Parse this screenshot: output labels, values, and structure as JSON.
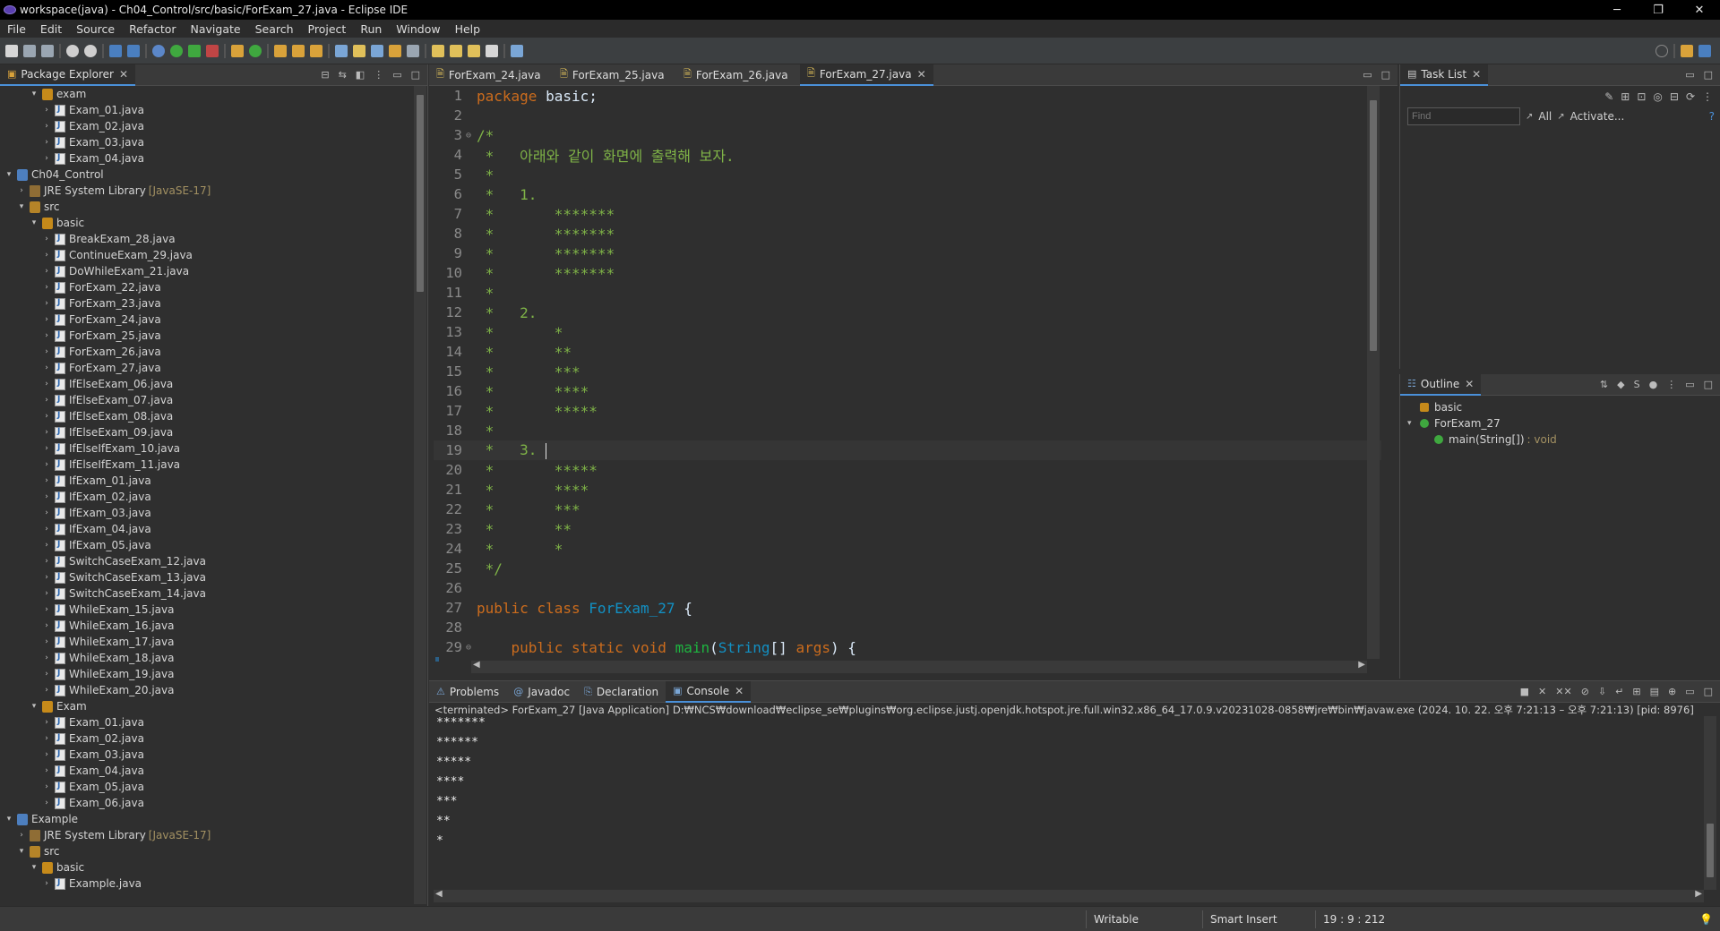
{
  "window": {
    "title": "workspace(java) - Ch04_Control/src/basic/ForExam_27.java - Eclipse IDE",
    "controls": [
      "─",
      "❐",
      "✕"
    ]
  },
  "menu": [
    "File",
    "Edit",
    "Source",
    "Refactor",
    "Navigate",
    "Search",
    "Project",
    "Run",
    "Window",
    "Help"
  ],
  "package_explorer": {
    "title": "Package Explorer",
    "items": [
      {
        "label": "exam",
        "indent": 2,
        "icon": "pkg",
        "twisty": "▾"
      },
      {
        "label": "Exam_01.java",
        "indent": 3,
        "icon": "java",
        "twisty": "›"
      },
      {
        "label": "Exam_02.java",
        "indent": 3,
        "icon": "java",
        "twisty": "›"
      },
      {
        "label": "Exam_03.java",
        "indent": 3,
        "icon": "java",
        "twisty": "›"
      },
      {
        "label": "Exam_04.java",
        "indent": 3,
        "icon": "java",
        "twisty": "›"
      },
      {
        "label": "Ch04_Control",
        "indent": 0,
        "icon": "proj",
        "twisty": "▾"
      },
      {
        "label": "JRE System Library",
        "extra": "[JavaSE-17]",
        "indent": 1,
        "icon": "lib",
        "twisty": "›"
      },
      {
        "label": "src",
        "indent": 1,
        "icon": "src",
        "twisty": "▾"
      },
      {
        "label": "basic",
        "indent": 2,
        "icon": "pkg",
        "twisty": "▾"
      },
      {
        "label": "BreakExam_28.java",
        "indent": 3,
        "icon": "java",
        "twisty": "›"
      },
      {
        "label": "ContinueExam_29.java",
        "indent": 3,
        "icon": "java",
        "twisty": "›"
      },
      {
        "label": "DoWhileExam_21.java",
        "indent": 3,
        "icon": "java",
        "twisty": "›"
      },
      {
        "label": "ForExam_22.java",
        "indent": 3,
        "icon": "java",
        "twisty": "›"
      },
      {
        "label": "ForExam_23.java",
        "indent": 3,
        "icon": "java",
        "twisty": "›"
      },
      {
        "label": "ForExam_24.java",
        "indent": 3,
        "icon": "java",
        "twisty": "›"
      },
      {
        "label": "ForExam_25.java",
        "indent": 3,
        "icon": "java",
        "twisty": "›"
      },
      {
        "label": "ForExam_26.java",
        "indent": 3,
        "icon": "java",
        "twisty": "›"
      },
      {
        "label": "ForExam_27.java",
        "indent": 3,
        "icon": "java",
        "twisty": "›"
      },
      {
        "label": "IfElseExam_06.java",
        "indent": 3,
        "icon": "java",
        "twisty": "›"
      },
      {
        "label": "IfElseExam_07.java",
        "indent": 3,
        "icon": "java",
        "twisty": "›"
      },
      {
        "label": "IfElseExam_08.java",
        "indent": 3,
        "icon": "java",
        "twisty": "›"
      },
      {
        "label": "IfElseExam_09.java",
        "indent": 3,
        "icon": "java",
        "twisty": "›"
      },
      {
        "label": "IfElseIfExam_10.java",
        "indent": 3,
        "icon": "java",
        "twisty": "›"
      },
      {
        "label": "IfElseIfExam_11.java",
        "indent": 3,
        "icon": "java",
        "twisty": "›"
      },
      {
        "label": "IfExam_01.java",
        "indent": 3,
        "icon": "java",
        "twisty": "›"
      },
      {
        "label": "IfExam_02.java",
        "indent": 3,
        "icon": "java",
        "twisty": "›"
      },
      {
        "label": "IfExam_03.java",
        "indent": 3,
        "icon": "java",
        "twisty": "›"
      },
      {
        "label": "IfExam_04.java",
        "indent": 3,
        "icon": "java",
        "twisty": "›"
      },
      {
        "label": "IfExam_05.java",
        "indent": 3,
        "icon": "java",
        "twisty": "›"
      },
      {
        "label": "SwitchCaseExam_12.java",
        "indent": 3,
        "icon": "java",
        "twisty": "›"
      },
      {
        "label": "SwitchCaseExam_13.java",
        "indent": 3,
        "icon": "java",
        "twisty": "›"
      },
      {
        "label": "SwitchCaseExam_14.java",
        "indent": 3,
        "icon": "java",
        "twisty": "›"
      },
      {
        "label": "WhileExam_15.java",
        "indent": 3,
        "icon": "java",
        "twisty": "›"
      },
      {
        "label": "WhileExam_16.java",
        "indent": 3,
        "icon": "java",
        "twisty": "›"
      },
      {
        "label": "WhileExam_17.java",
        "indent": 3,
        "icon": "java",
        "twisty": "›"
      },
      {
        "label": "WhileExam_18.java",
        "indent": 3,
        "icon": "java",
        "twisty": "›"
      },
      {
        "label": "WhileExam_19.java",
        "indent": 3,
        "icon": "java",
        "twisty": "›"
      },
      {
        "label": "WhileExam_20.java",
        "indent": 3,
        "icon": "java",
        "twisty": "›"
      },
      {
        "label": "Exam",
        "indent": 2,
        "icon": "pkg",
        "twisty": "▾"
      },
      {
        "label": "Exam_01.java",
        "indent": 3,
        "icon": "java",
        "twisty": "›"
      },
      {
        "label": "Exam_02.java",
        "indent": 3,
        "icon": "java",
        "twisty": "›"
      },
      {
        "label": "Exam_03.java",
        "indent": 3,
        "icon": "java",
        "twisty": "›"
      },
      {
        "label": "Exam_04.java",
        "indent": 3,
        "icon": "java",
        "twisty": "›"
      },
      {
        "label": "Exam_05.java",
        "indent": 3,
        "icon": "java",
        "twisty": "›"
      },
      {
        "label": "Exam_06.java",
        "indent": 3,
        "icon": "java",
        "twisty": "›"
      },
      {
        "label": "Example",
        "indent": 0,
        "icon": "proj",
        "twisty": "▾"
      },
      {
        "label": "JRE System Library",
        "extra": "[JavaSE-17]",
        "indent": 1,
        "icon": "lib",
        "twisty": "›"
      },
      {
        "label": "src",
        "indent": 1,
        "icon": "src",
        "twisty": "▾"
      },
      {
        "label": "basic",
        "indent": 2,
        "icon": "pkg",
        "twisty": "▾"
      },
      {
        "label": "Example.java",
        "indent": 3,
        "icon": "java",
        "twisty": "›"
      }
    ]
  },
  "editor": {
    "tabs": [
      "ForExam_24.java",
      "ForExam_25.java",
      "ForExam_26.java",
      "ForExam_27.java"
    ],
    "active_tab": 3,
    "lines": [
      {
        "n": "1",
        "parts": [
          [
            "kw",
            "package"
          ],
          [
            "code",
            " basic;"
          ]
        ]
      },
      {
        "n": "2",
        "parts": []
      },
      {
        "n": "3",
        "fold": "⊖",
        "parts": [
          [
            "cm",
            "/*"
          ]
        ]
      },
      {
        "n": "4",
        "parts": [
          [
            "cm",
            " *   아래와 같이 화면에 출력해 보자."
          ]
        ]
      },
      {
        "n": "5",
        "parts": [
          [
            "cm",
            " *"
          ]
        ]
      },
      {
        "n": "6",
        "parts": [
          [
            "cm",
            " *   1."
          ]
        ]
      },
      {
        "n": "7",
        "parts": [
          [
            "cm",
            " *       *******"
          ]
        ]
      },
      {
        "n": "8",
        "parts": [
          [
            "cm",
            " *       *******"
          ]
        ]
      },
      {
        "n": "9",
        "parts": [
          [
            "cm",
            " *       *******"
          ]
        ]
      },
      {
        "n": "10",
        "parts": [
          [
            "cm",
            " *       *******"
          ]
        ]
      },
      {
        "n": "11",
        "parts": [
          [
            "cm",
            " *"
          ]
        ]
      },
      {
        "n": "12",
        "parts": [
          [
            "cm",
            " *   2."
          ]
        ]
      },
      {
        "n": "13",
        "parts": [
          [
            "cm",
            " *       *"
          ]
        ]
      },
      {
        "n": "14",
        "parts": [
          [
            "cm",
            " *       **"
          ]
        ]
      },
      {
        "n": "15",
        "parts": [
          [
            "cm",
            " *       ***"
          ]
        ]
      },
      {
        "n": "16",
        "parts": [
          [
            "cm",
            " *       ****"
          ]
        ]
      },
      {
        "n": "17",
        "parts": [
          [
            "cm",
            " *       *****"
          ]
        ]
      },
      {
        "n": "18",
        "parts": [
          [
            "cm",
            " *"
          ]
        ]
      },
      {
        "n": "19",
        "cur": true,
        "parts": [
          [
            "cm",
            " *   3. "
          ]
        ]
      },
      {
        "n": "20",
        "parts": [
          [
            "cm",
            " *       *****"
          ]
        ]
      },
      {
        "n": "21",
        "parts": [
          [
            "cm",
            " *       ****"
          ]
        ]
      },
      {
        "n": "22",
        "parts": [
          [
            "cm",
            " *       ***"
          ]
        ]
      },
      {
        "n": "23",
        "parts": [
          [
            "cm",
            " *       **"
          ]
        ]
      },
      {
        "n": "24",
        "parts": [
          [
            "cm",
            " *       *"
          ]
        ]
      },
      {
        "n": "25",
        "parts": [
          [
            "cm",
            " */"
          ]
        ]
      },
      {
        "n": "26",
        "parts": []
      },
      {
        "n": "27",
        "parts": [
          [
            "kw",
            "public class "
          ],
          [
            "typ",
            "ForExam_27"
          ],
          [
            "code",
            " {"
          ]
        ]
      },
      {
        "n": "28",
        "parts": []
      },
      {
        "n": "29",
        "fold": "⊖",
        "parts": [
          [
            "code",
            "    "
          ],
          [
            "kw",
            "public static void "
          ],
          [
            "fn",
            "main"
          ],
          [
            "code",
            "("
          ],
          [
            "typ",
            "String"
          ],
          [
            "code",
            "[] "
          ],
          [
            "kw",
            "args"
          ],
          [
            "code",
            ") {"
          ]
        ]
      }
    ]
  },
  "task_list": {
    "title": "Task List",
    "find_placeholder": "Find",
    "all": "All",
    "activate": "Activate..."
  },
  "outline": {
    "title": "Outline",
    "items": [
      {
        "label": "basic",
        "indent": 0,
        "icon": "pkg"
      },
      {
        "label": "ForExam_27",
        "indent": 0,
        "icon": "cls",
        "twisty": "▾"
      },
      {
        "label": "main(String[])",
        "extra": ": void",
        "indent": 1,
        "icon": "method"
      }
    ]
  },
  "bottom": {
    "tabs": [
      "Problems",
      "Javadoc",
      "Declaration",
      "Console"
    ],
    "active_tab": 3,
    "terminated": "<terminated> ForExam_27 [Java Application] D:₩NCS₩download₩eclipse_se₩plugins₩org.eclipse.justj.openjdk.hotspot.jre.full.win32.x86_64_17.0.9.v20231028-0858₩jre₩bin₩javaw.exe  (2024. 10. 22. 오후 7:21:13 – 오후 7:21:13) [pid: 8976]",
    "output": [
      "*******",
      "******",
      "*****",
      "****",
      "***",
      "**",
      "*"
    ]
  },
  "status": {
    "writable": "Writable",
    "insert": "Smart Insert",
    "position": "19 : 9 : 212"
  },
  "colors": {
    "accent": "#4a90d9",
    "background": "#2f2f2f",
    "keyword": "#cc6c1d",
    "comment": "#7fb347"
  }
}
